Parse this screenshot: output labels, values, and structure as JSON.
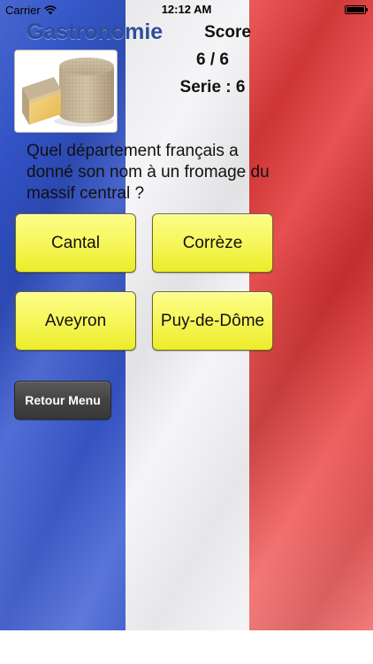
{
  "status_bar": {
    "carrier": "Carrier",
    "time": "12:12 AM",
    "battery_level": 1.0
  },
  "header": {
    "title": "Gastronomie",
    "score_label": "Score",
    "score_value": "6 / 6",
    "serie_value": "Serie : 6"
  },
  "question": {
    "text": "Quel département français a donné son nom à un fromage du massif central ?",
    "image_icon": "cheese-wheel"
  },
  "answers": [
    {
      "label": "Cantal"
    },
    {
      "label": "Corrèze"
    },
    {
      "label": "Aveyron"
    },
    {
      "label": "Puy-de-Dôme"
    }
  ],
  "menu": {
    "back_label": "Retour Menu"
  },
  "colors": {
    "flag_blue": "#3456c8",
    "flag_white": "#f5f5f7",
    "flag_red": "#e83f3f",
    "title_blue": "#2f4d9c",
    "button_yellow": "#f7f760",
    "menu_dark": "#444444"
  }
}
